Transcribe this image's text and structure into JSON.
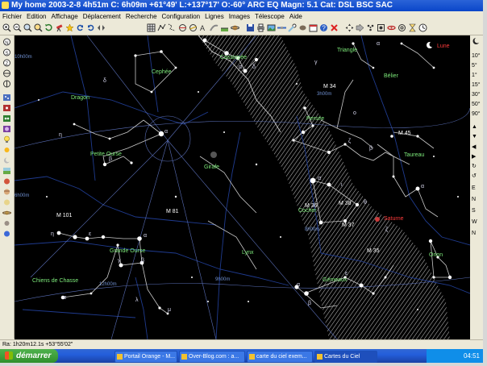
{
  "window": {
    "title": "My home 2003-2-8   4h51m C:  6h09m +61°49' L:+137°17' O:-60° ARC EQ Magn: 5.1 Cat: DSL BSC SAC"
  },
  "menu": {
    "items": [
      "Fichier",
      "Edition",
      "Affichage",
      "Déplacement",
      "Recherche",
      "Configuration",
      "Lignes",
      "Images",
      "Télescope",
      "Aide"
    ]
  },
  "sky": {
    "constellations": [
      {
        "key": "cassiopee",
        "label": "Cassiopée"
      },
      {
        "key": "cephee",
        "label": "Cephée"
      },
      {
        "key": "dragon",
        "label": "Dragon"
      },
      {
        "key": "petite_ourse",
        "label": "Petite Ourse"
      },
      {
        "key": "girafe",
        "label": "Girafe"
      },
      {
        "key": "persee",
        "label": "Persée"
      },
      {
        "key": "triangle",
        "label": "Triangle"
      },
      {
        "key": "belier",
        "label": "Bélier"
      },
      {
        "key": "taureau",
        "label": "Taureau"
      },
      {
        "key": "grande_ourse",
        "label": "Grande Ourse"
      },
      {
        "key": "lynx",
        "label": "Lynx"
      },
      {
        "key": "chiens_chasse",
        "label": "Chiens de Chasse"
      },
      {
        "key": "gemeaux",
        "label": "Gémeaux"
      },
      {
        "key": "cocher",
        "label": "Cocher"
      },
      {
        "key": "orion",
        "label": "Orion"
      }
    ],
    "objects": [
      {
        "key": "m34",
        "label": "M 34"
      },
      {
        "key": "m45",
        "label": "M 45"
      },
      {
        "key": "m38",
        "label": "M 38"
      },
      {
        "key": "m36",
        "label": "M 36"
      },
      {
        "key": "m37",
        "label": "M 37"
      },
      {
        "key": "m35",
        "label": "M 35"
      },
      {
        "key": "m81",
        "label": "M 81"
      },
      {
        "key": "m101",
        "label": "M 101"
      }
    ],
    "planets": [
      {
        "key": "lune",
        "label": "Lune"
      },
      {
        "key": "saturne",
        "label": "Saturne"
      }
    ],
    "greek": [
      "α",
      "β",
      "γ",
      "δ",
      "ε",
      "ζ",
      "η",
      "θ",
      "ι",
      "κ",
      "λ",
      "μ",
      "ο",
      "ε"
    ],
    "grid_labels": [
      "10h00m",
      "9h00m",
      "12h00m",
      "8h00m",
      "3h00m",
      "6h00m",
      "4h00m",
      "2h00m",
      "20h00m"
    ]
  },
  "fov": {
    "labels": [
      "10°",
      "5°",
      "1°",
      "15°",
      "30°",
      "50°",
      "90°",
      "E",
      "N",
      "S",
      "W",
      "N"
    ]
  },
  "statusbar": {
    "text": "Ra: 1h20m12.1s +53°55'02\""
  },
  "taskbar": {
    "start_label": "démarrer",
    "tasks": [
      {
        "label": "Portail Orange - M...",
        "active": false
      },
      {
        "label": "Over-Blog.com : a...",
        "active": false
      },
      {
        "label": "carte du ciel exem...",
        "active": false
      },
      {
        "label": "Cartes du Ciel",
        "active": true
      }
    ],
    "clock": "04:51"
  }
}
